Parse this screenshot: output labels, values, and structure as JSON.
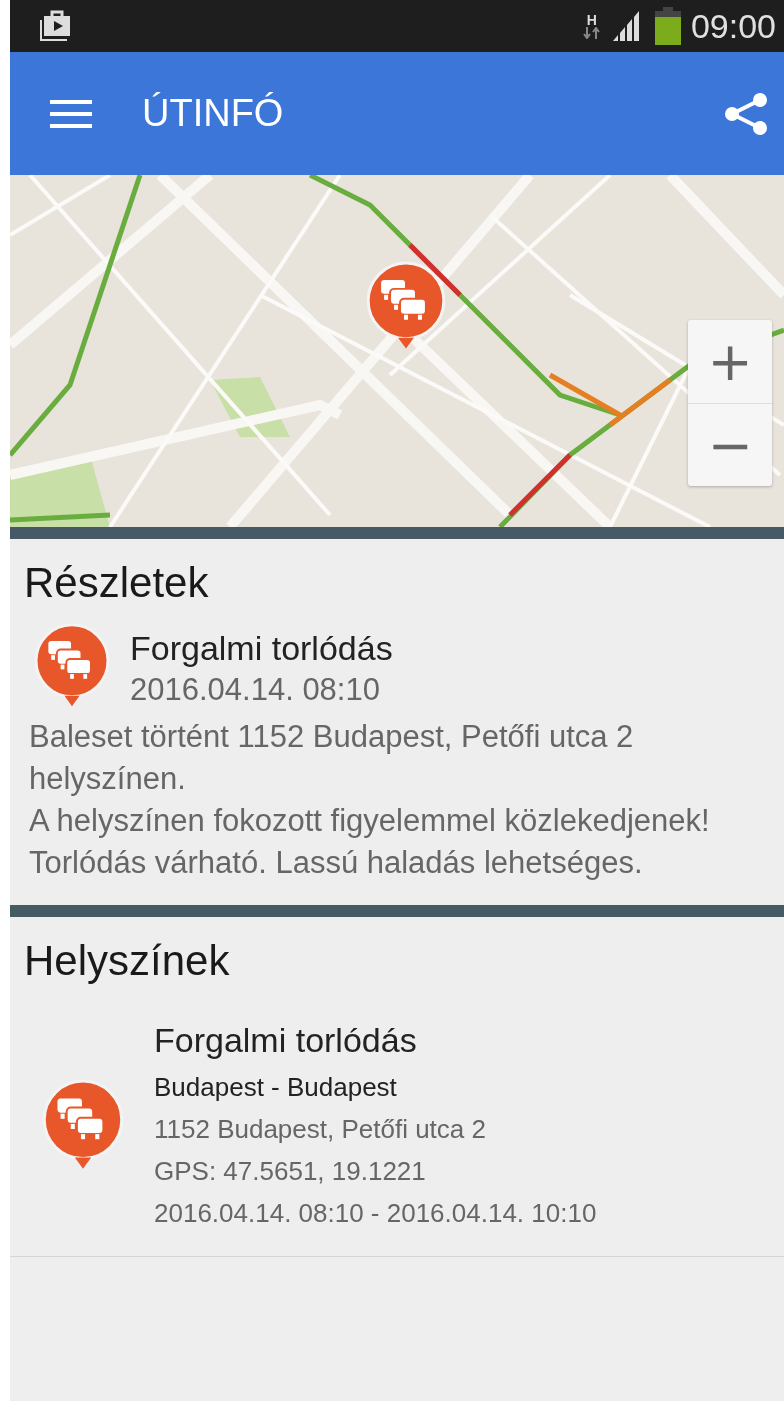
{
  "status_bar": {
    "time": "09:00",
    "network": "H"
  },
  "app_bar": {
    "title": "ÚTINFÓ"
  },
  "map": {
    "zoom_in": "+",
    "zoom_out": "−"
  },
  "details": {
    "heading": "Részletek",
    "title": "Forgalmi torlódás",
    "date": "2016.04.14. 08:10",
    "description": [
      "Baleset történt 1152 Budapest, Petőfi utca 2 helyszínen.",
      "A helyszínen fokozott figyelemmel közlekedjenek!",
      "Torlódás várható. Lassú haladás lehetséges."
    ]
  },
  "locations": {
    "heading": "Helyszínek",
    "items": [
      {
        "title": "Forgalmi torlódás",
        "region": "Budapest - Budapest",
        "address": "1152 Budapest, Petőfi utca 2",
        "gps": "GPS: 47.5651, 19.1221",
        "period": "2016.04.14. 08:10 - 2016.04.14. 10:10"
      }
    ]
  }
}
